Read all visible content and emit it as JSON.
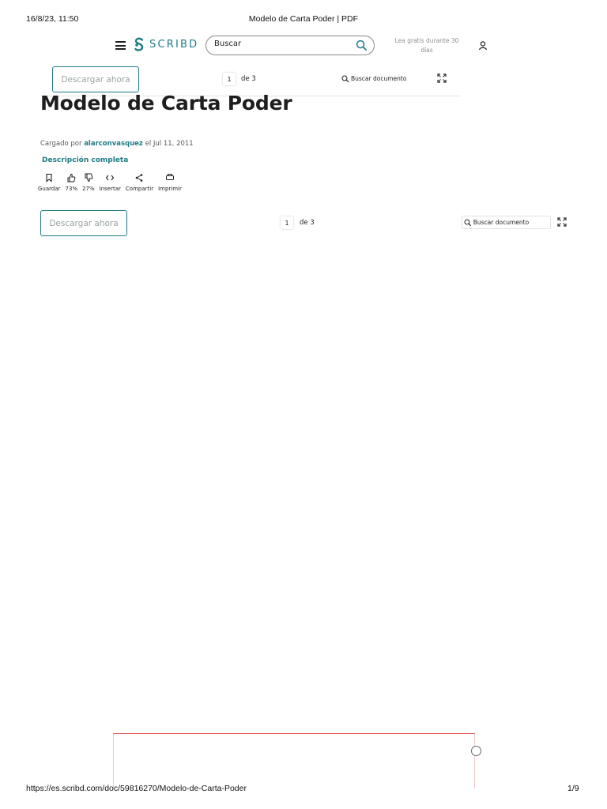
{
  "print_header": {
    "datetime": "16/8/23, 11:50",
    "page_title": "Modelo de Carta Poder | PDF"
  },
  "print_footer": {
    "url": "https://es.scribd.com/doc/59816270/Modelo-de-Carta-Poder",
    "page_count": "1/9"
  },
  "nav": {
    "logo_text": "SCRIBD",
    "search_placeholder": "Buscar",
    "promo_text": "Lea gratis durante 30 días"
  },
  "toolbar_top": {
    "download_label": "Descargar ahora",
    "page_number": "1",
    "page_of": "de 3",
    "doc_search_placeholder": "Buscar documento"
  },
  "document": {
    "title": "Modelo de Carta Poder",
    "uploaded_prefix": "Cargado por",
    "author": "alarconvasquez",
    "uploaded_suffix": "el Jul 11, 2011",
    "description_link": "Descripción completa"
  },
  "actions": {
    "save": "Guardar",
    "like_pct": "73%",
    "dislike_pct": "27%",
    "embed": "Insertar",
    "share": "Compartir",
    "print": "Imprimir"
  },
  "toolbar_bottom": {
    "download_label": "Descargar ahora",
    "page_number": "1",
    "page_of": "de 3",
    "doc_search_placeholder": "Buscar documento"
  },
  "colors": {
    "brand": "#1e7b85",
    "text": "#1e1e1e",
    "muted": "#8d8d8d"
  }
}
